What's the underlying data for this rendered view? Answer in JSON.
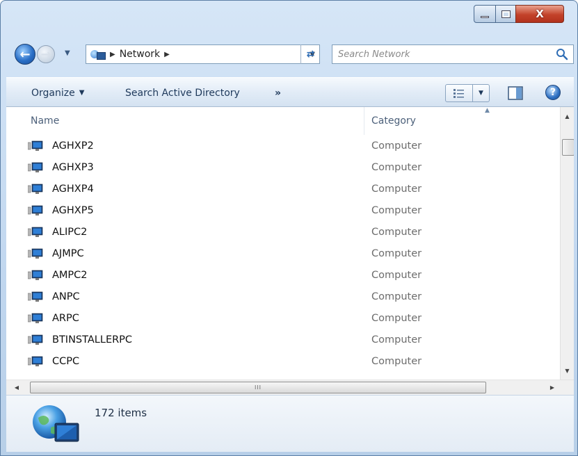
{
  "window": {
    "controls": {
      "minimize_glyph": "–",
      "maximize_glyph": "□",
      "close_glyph": "X"
    }
  },
  "navigation": {
    "back_icon": "back-arrow-icon",
    "forward_icon": "forward-arrow-icon",
    "address": {
      "icon": "network-icon",
      "crumbs": [
        "Network"
      ]
    },
    "search_placeholder": "Search Network"
  },
  "toolbar": {
    "organize_label": "Organize",
    "search_ad_label": "Search Active Directory",
    "more_label": "»"
  },
  "list": {
    "columns": {
      "name": "Name",
      "category": "Category"
    },
    "rows": [
      {
        "name": "AGHXP2",
        "category": "Computer"
      },
      {
        "name": "AGHXP3",
        "category": "Computer"
      },
      {
        "name": "AGHXP4",
        "category": "Computer"
      },
      {
        "name": "AGHXP5",
        "category": "Computer"
      },
      {
        "name": "ALIPC2",
        "category": "Computer"
      },
      {
        "name": "AJMPC",
        "category": "Computer"
      },
      {
        "name": "AMPC2",
        "category": "Computer"
      },
      {
        "name": "ANPC",
        "category": "Computer"
      },
      {
        "name": "ARPC",
        "category": "Computer"
      },
      {
        "name": "BTINSTALLERPC",
        "category": "Computer"
      },
      {
        "name": "CCPC",
        "category": "Computer"
      }
    ]
  },
  "status": {
    "item_count": "172 items",
    "icon": "network-globe-icon"
  },
  "colors": {
    "accent": "#2d6fc2",
    "close": "#c3422a"
  }
}
